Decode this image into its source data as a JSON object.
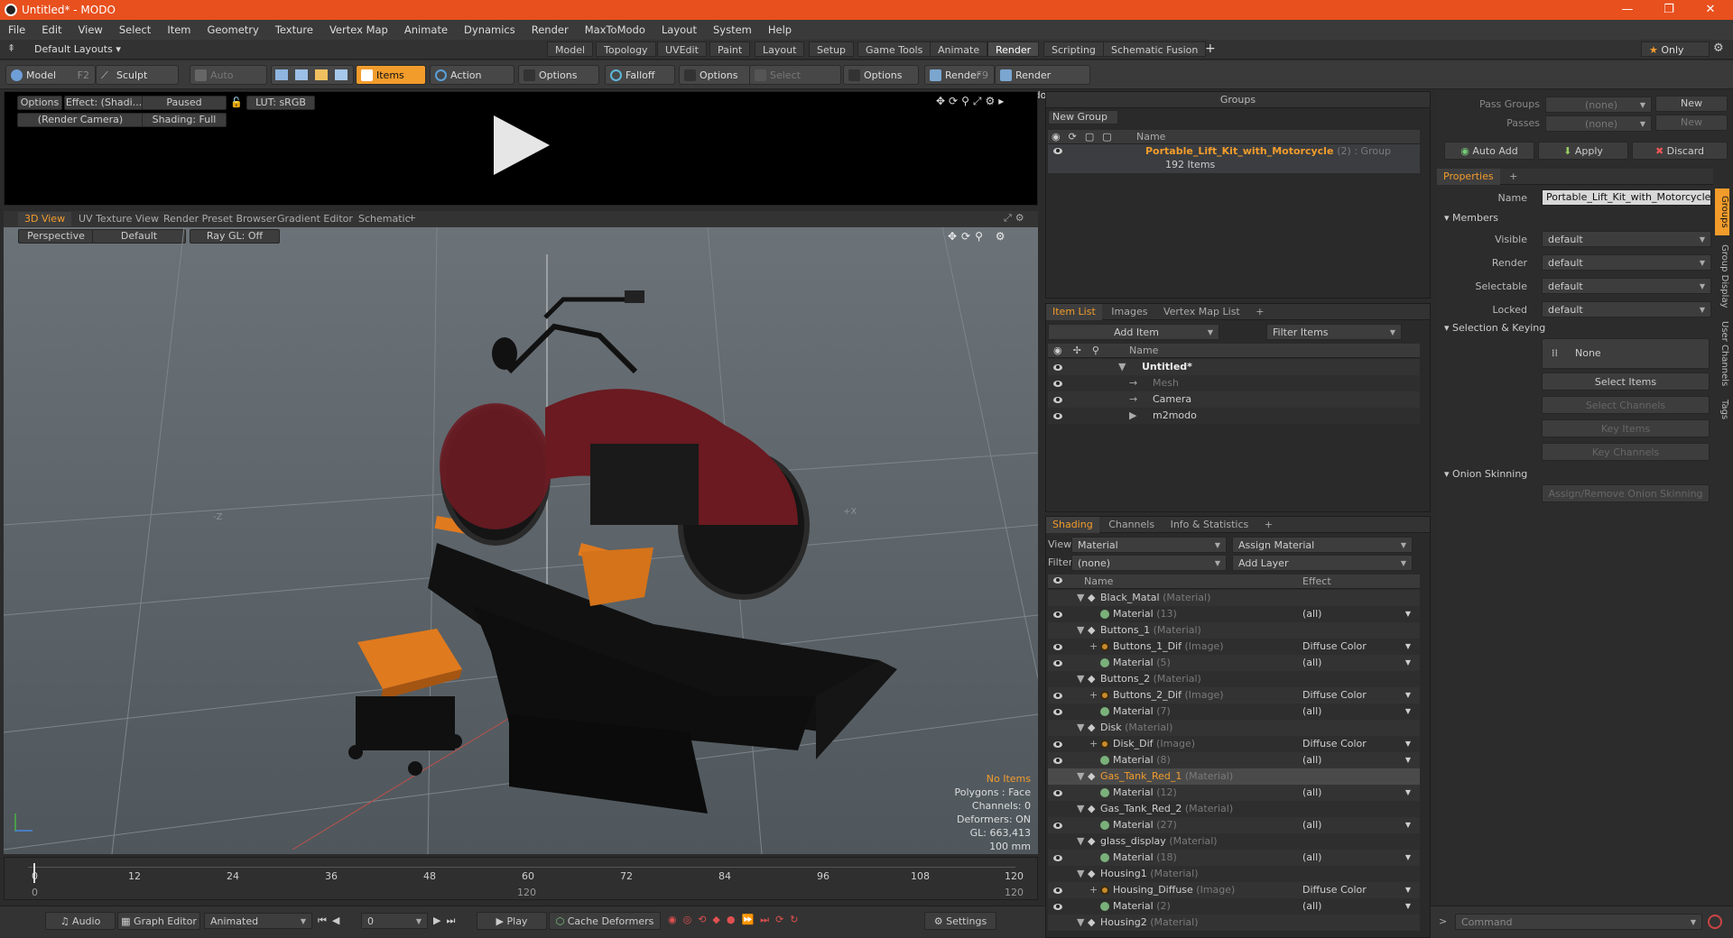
{
  "window": {
    "title": "Untitled* - MODO",
    "min": "—",
    "max": "❐",
    "close": "✕"
  },
  "menu": [
    "File",
    "Edit",
    "View",
    "Select",
    "Item",
    "Geometry",
    "Texture",
    "Vertex Map",
    "Animate",
    "Dynamics",
    "Render",
    "MaxToModo",
    "Layout",
    "System",
    "Help"
  ],
  "layouts": {
    "label": "Default Layouts",
    "tabs": [
      "Model",
      "Topology",
      "UVEdit",
      "Paint",
      "Layout",
      "Setup",
      "Game Tools",
      "Animate",
      "Render",
      "Scripting",
      "Schematic Fusion"
    ],
    "active": "Render",
    "plus": "+",
    "only": "Only"
  },
  "toolbar": {
    "model": "Model",
    "model_key": "F2",
    "sculpt": "Sculpt",
    "auto_select": "Auto Select",
    "items": "Items",
    "action_center": "Action Center",
    "options1": "Options",
    "falloff": "Falloff",
    "options2": "Options",
    "select_through": "Select Through",
    "options3": "Options",
    "render": "Render",
    "render_key": "F9",
    "render_window": "Render Window"
  },
  "render_preview": {
    "options": "Options",
    "effect": "Effect: (Shadi...",
    "paused": "Paused",
    "lut": "LUT: sRGB",
    "camera": "(Render Camera)",
    "shading": "Shading: Full"
  },
  "viewport_tabs": [
    "3D View",
    "UV Texture View",
    "Render Preset Browser",
    "Gradient Editor",
    "Schematic"
  ],
  "viewport": {
    "perspective": "Perspective",
    "default": "Default",
    "raygl": "Ray GL: Off",
    "axis_neg_z": "-Z",
    "axis_pos_x": "+X",
    "stats": {
      "no_items": "No Items",
      "polygons": "Polygons : Face",
      "channels": "Channels: 0",
      "deformers": "Deformers: ON",
      "gl": "GL: 663,413",
      "scale": "100 mm"
    }
  },
  "timeline": {
    "ticks": [
      "0",
      "12",
      "24",
      "36",
      "48",
      "60",
      "72",
      "84",
      "96",
      "108",
      "120"
    ],
    "ticks2": [
      "0",
      "120",
      "120"
    ]
  },
  "bottombar": {
    "audio": "Audio",
    "graph_editor": "Graph Editor",
    "animated": "Animated",
    "frame": "0",
    "play": "Play",
    "cache": "Cache Deformers",
    "settings": "Settings",
    "command": "Command"
  },
  "groups": {
    "title": "Groups",
    "new_group": "New Group",
    "col_name": "Name",
    "item_name": "Portable_Lift_Kit_with_Motorcycle",
    "item_suffix": "(2) : Group",
    "item_count": "192 Items"
  },
  "itemlist": {
    "tabs": [
      "Item List",
      "Images",
      "Vertex Map List"
    ],
    "add_item": "Add Item",
    "filter": "Filter Items",
    "col_name": "Name",
    "items": [
      {
        "name": "Untitled*",
        "level": 0,
        "style": "bold"
      },
      {
        "name": "Mesh",
        "level": 1,
        "style": "dim"
      },
      {
        "name": "Camera",
        "level": 1,
        "style": "normal"
      },
      {
        "name": "m2modo",
        "level": 1,
        "style": "normal"
      }
    ]
  },
  "shading": {
    "tabs": [
      "Shading",
      "Channels",
      "Info & Statistics"
    ],
    "view_label": "View",
    "view_value": "Material",
    "assign": "Assign Material",
    "filter_label": "Filter",
    "filter_value": "(none)",
    "add_layer": "Add Layer",
    "col_name": "Name",
    "col_effect": "Effect",
    "rows": [
      {
        "indent": 0,
        "name": "Black_Matal",
        "tag": "(Material)",
        "effect": "",
        "kind": "group"
      },
      {
        "indent": 1,
        "name": "Material",
        "tag": "(13)",
        "effect": "(all)",
        "kind": "mat"
      },
      {
        "indent": 0,
        "name": "Buttons_1",
        "tag": "(Material)",
        "effect": "",
        "kind": "group"
      },
      {
        "indent": 1,
        "name": "Buttons_1_Dif",
        "tag": "(Image)",
        "effect": "Diffuse Color",
        "kind": "img"
      },
      {
        "indent": 1,
        "name": "Material",
        "tag": "(5)",
        "effect": "(all)",
        "kind": "mat"
      },
      {
        "indent": 0,
        "name": "Buttons_2",
        "tag": "(Material)",
        "effect": "",
        "kind": "group"
      },
      {
        "indent": 1,
        "name": "Buttons_2_Dif",
        "tag": "(Image)",
        "effect": "Diffuse Color",
        "kind": "img"
      },
      {
        "indent": 1,
        "name": "Material",
        "tag": "(7)",
        "effect": "(all)",
        "kind": "mat"
      },
      {
        "indent": 0,
        "name": "Disk",
        "tag": "(Material)",
        "effect": "",
        "kind": "group"
      },
      {
        "indent": 1,
        "name": "Disk_Dif",
        "tag": "(Image)",
        "effect": "Diffuse Color",
        "kind": "img"
      },
      {
        "indent": 1,
        "name": "Material",
        "tag": "(8)",
        "effect": "(all)",
        "kind": "mat"
      },
      {
        "indent": 0,
        "name": "Gas_Tank_Red_1",
        "tag": "(Material)",
        "effect": "",
        "kind": "group",
        "sel": true
      },
      {
        "indent": 1,
        "name": "Material",
        "tag": "(12)",
        "effect": "(all)",
        "kind": "mat"
      },
      {
        "indent": 0,
        "name": "Gas_Tank_Red_2",
        "tag": "(Material)",
        "effect": "",
        "kind": "group"
      },
      {
        "indent": 1,
        "name": "Material",
        "tag": "(27)",
        "effect": "(all)",
        "kind": "mat"
      },
      {
        "indent": 0,
        "name": "glass_display",
        "tag": "(Material)",
        "effect": "",
        "kind": "group"
      },
      {
        "indent": 1,
        "name": "Material",
        "tag": "(18)",
        "effect": "(all)",
        "kind": "mat"
      },
      {
        "indent": 0,
        "name": "Housing1",
        "tag": "(Material)",
        "effect": "",
        "kind": "group"
      },
      {
        "indent": 1,
        "name": "Housing_Diffuse",
        "tag": "(Image)",
        "effect": "Diffuse Color",
        "kind": "img"
      },
      {
        "indent": 1,
        "name": "Material",
        "tag": "(2)",
        "effect": "(all)",
        "kind": "mat"
      },
      {
        "indent": 0,
        "name": "Housing2",
        "tag": "(Material)",
        "effect": "",
        "kind": "group"
      }
    ]
  },
  "passes": {
    "pass_groups": "Pass Groups",
    "passes": "Passes",
    "none": "(none)",
    "new": "New",
    "auto_add": "Auto Add",
    "apply": "Apply",
    "discard": "Discard"
  },
  "properties": {
    "tab": "Properties",
    "name_label": "Name",
    "name_value": "Portable_Lift_Kit_with_Motorcycle (",
    "members": "Members",
    "fields": [
      {
        "label": "Visible",
        "value": "default"
      },
      {
        "label": "Render",
        "value": "default"
      },
      {
        "label": "Selectable",
        "value": "default"
      },
      {
        "label": "Locked",
        "value": "default"
      }
    ],
    "sel_keying": "Selection & Keying",
    "none": "None",
    "select_items": "Select Items",
    "select_channels": "Select Channels",
    "key_items": "Key Items",
    "key_channels": "Key Channels",
    "onion": "Onion Skinning",
    "assign_onion": "Assign/Remove Onion Skinning",
    "side_tabs": [
      "Groups",
      "Group Display",
      "User Channels",
      "Tags"
    ]
  }
}
